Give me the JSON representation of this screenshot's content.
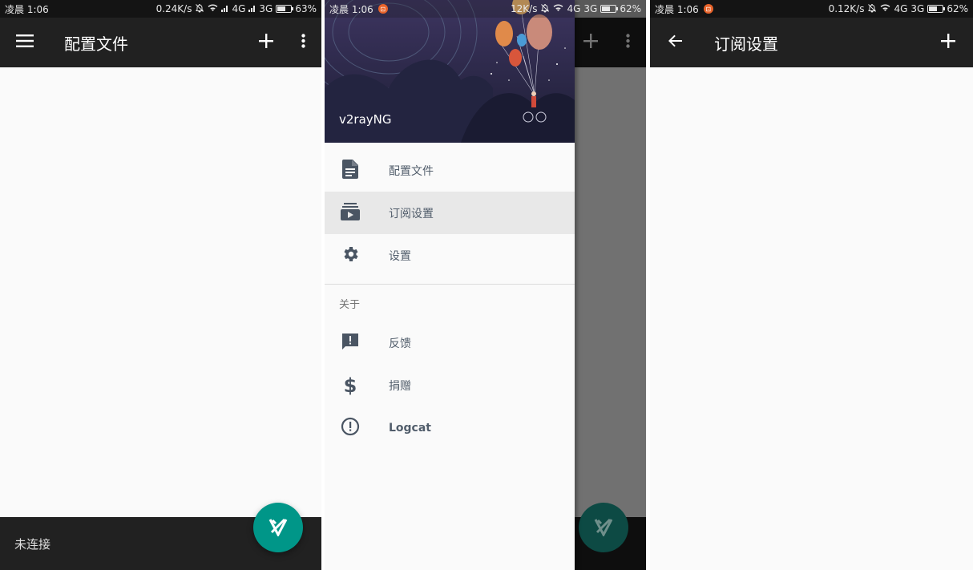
{
  "panel1": {
    "status": {
      "time": "凌晨 1:06",
      "speed": "0.24K/s",
      "net": "4G",
      "net2": "3G",
      "battery": "63%",
      "battery_level": 0.63
    },
    "toolbar": {
      "title": "配置文件"
    },
    "bottom": {
      "status_text": "未连接"
    }
  },
  "panel2": {
    "status": {
      "time": "凌晨 1:06",
      "speed": "12K/s",
      "net": "4G",
      "net2": "3G",
      "battery": "62%",
      "battery_level": 0.62
    },
    "drawer": {
      "app_name": "v2rayNG",
      "items": [
        {
          "label": "配置文件",
          "icon": "file-icon"
        },
        {
          "label": "订阅设置",
          "icon": "subscription-icon"
        },
        {
          "label": "设置",
          "icon": "gear-icon"
        }
      ],
      "section_title": "关于",
      "about_items": [
        {
          "label": "反馈",
          "icon": "feedback-icon"
        },
        {
          "label": "捐赠",
          "icon": "dollar-icon"
        },
        {
          "label": "Logcat",
          "icon": "alert-circle-icon"
        }
      ]
    }
  },
  "panel3": {
    "status": {
      "time": "凌晨 1:06",
      "speed": "0.12K/s",
      "net": "4G",
      "net2": "3G",
      "battery": "62%",
      "battery_level": 0.62
    },
    "toolbar": {
      "title": "订阅设置"
    }
  }
}
